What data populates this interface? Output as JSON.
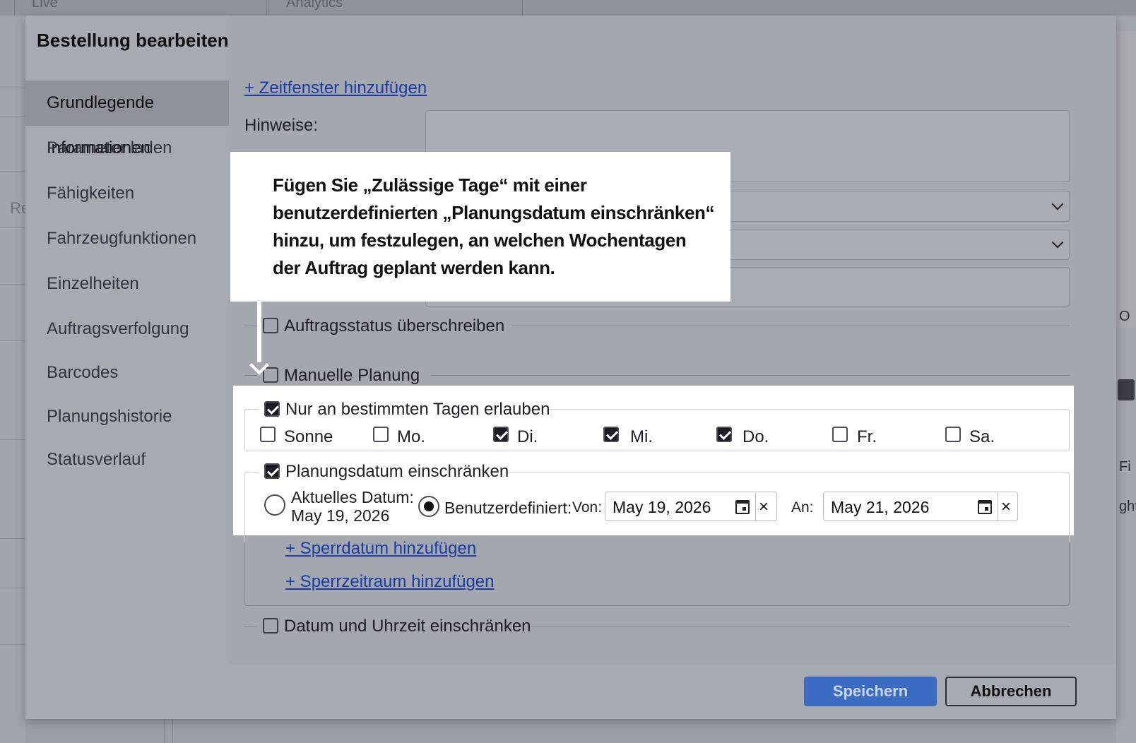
{
  "background": {
    "tabs": [
      "Live",
      "Analytics"
    ],
    "left_text": "Re",
    "right_texts": [
      "O",
      "Fi",
      "ght"
    ]
  },
  "modal": {
    "title": "Bestellung bearbeiten",
    "sidebar": [
      "Grundlegende Informationen",
      "Parameter laden",
      "Fähigkeiten",
      "Fahrzeugfunktionen",
      "Einzelheiten",
      "Auftragsverfolgung",
      "Barcodes",
      "Planungshistorie",
      "Statusverlauf"
    ],
    "add_timewindow_link": "+ Zeitfenster hinzufügen",
    "notes_label": "Hinweise:",
    "override_status_label": "Auftragsstatus überschreiben",
    "manual_planning_label": "Manuelle Planung",
    "allowed_days": {
      "label": "Nur an bestimmten Tagen erlauben",
      "checked": true,
      "days": [
        {
          "label": "Sonne",
          "checked": false
        },
        {
          "label": "Mo.",
          "checked": false
        },
        {
          "label": "Di.",
          "checked": true
        },
        {
          "label": "Mi.",
          "checked": true
        },
        {
          "label": "Do.",
          "checked": true
        },
        {
          "label": "Fr.",
          "checked": false
        },
        {
          "label": "Sa.",
          "checked": false
        }
      ]
    },
    "restrict_date": {
      "label": "Planungsdatum einschränken",
      "checked": true,
      "current_date_label": "Aktuelles Datum:",
      "current_date_value": "May 19, 2026",
      "custom_label": "Benutzerdefiniert:",
      "selected": "custom",
      "from_label": "Von:",
      "from_value": "May 19, 2026",
      "to_label": "An:",
      "to_value": "May 21, 2026",
      "clear_glyph": "×"
    },
    "add_blackout_date_link": "+ Sperrdatum hinzufügen",
    "add_blackout_period_link": "+ Sperrzeitraum hinzufügen",
    "restrict_datetime_label": "Datum und Uhrzeit einschränken",
    "save_label": "Speichern",
    "cancel_label": "Abbrechen"
  },
  "callout": {
    "text": "Fügen Sie „Zulässige Tage“ mit einer benutzerdefinierten „Planungsdatum einschränken“ hinzu, um festzulegen, an welchen Wochentagen der Auftrag geplant werden kann."
  }
}
